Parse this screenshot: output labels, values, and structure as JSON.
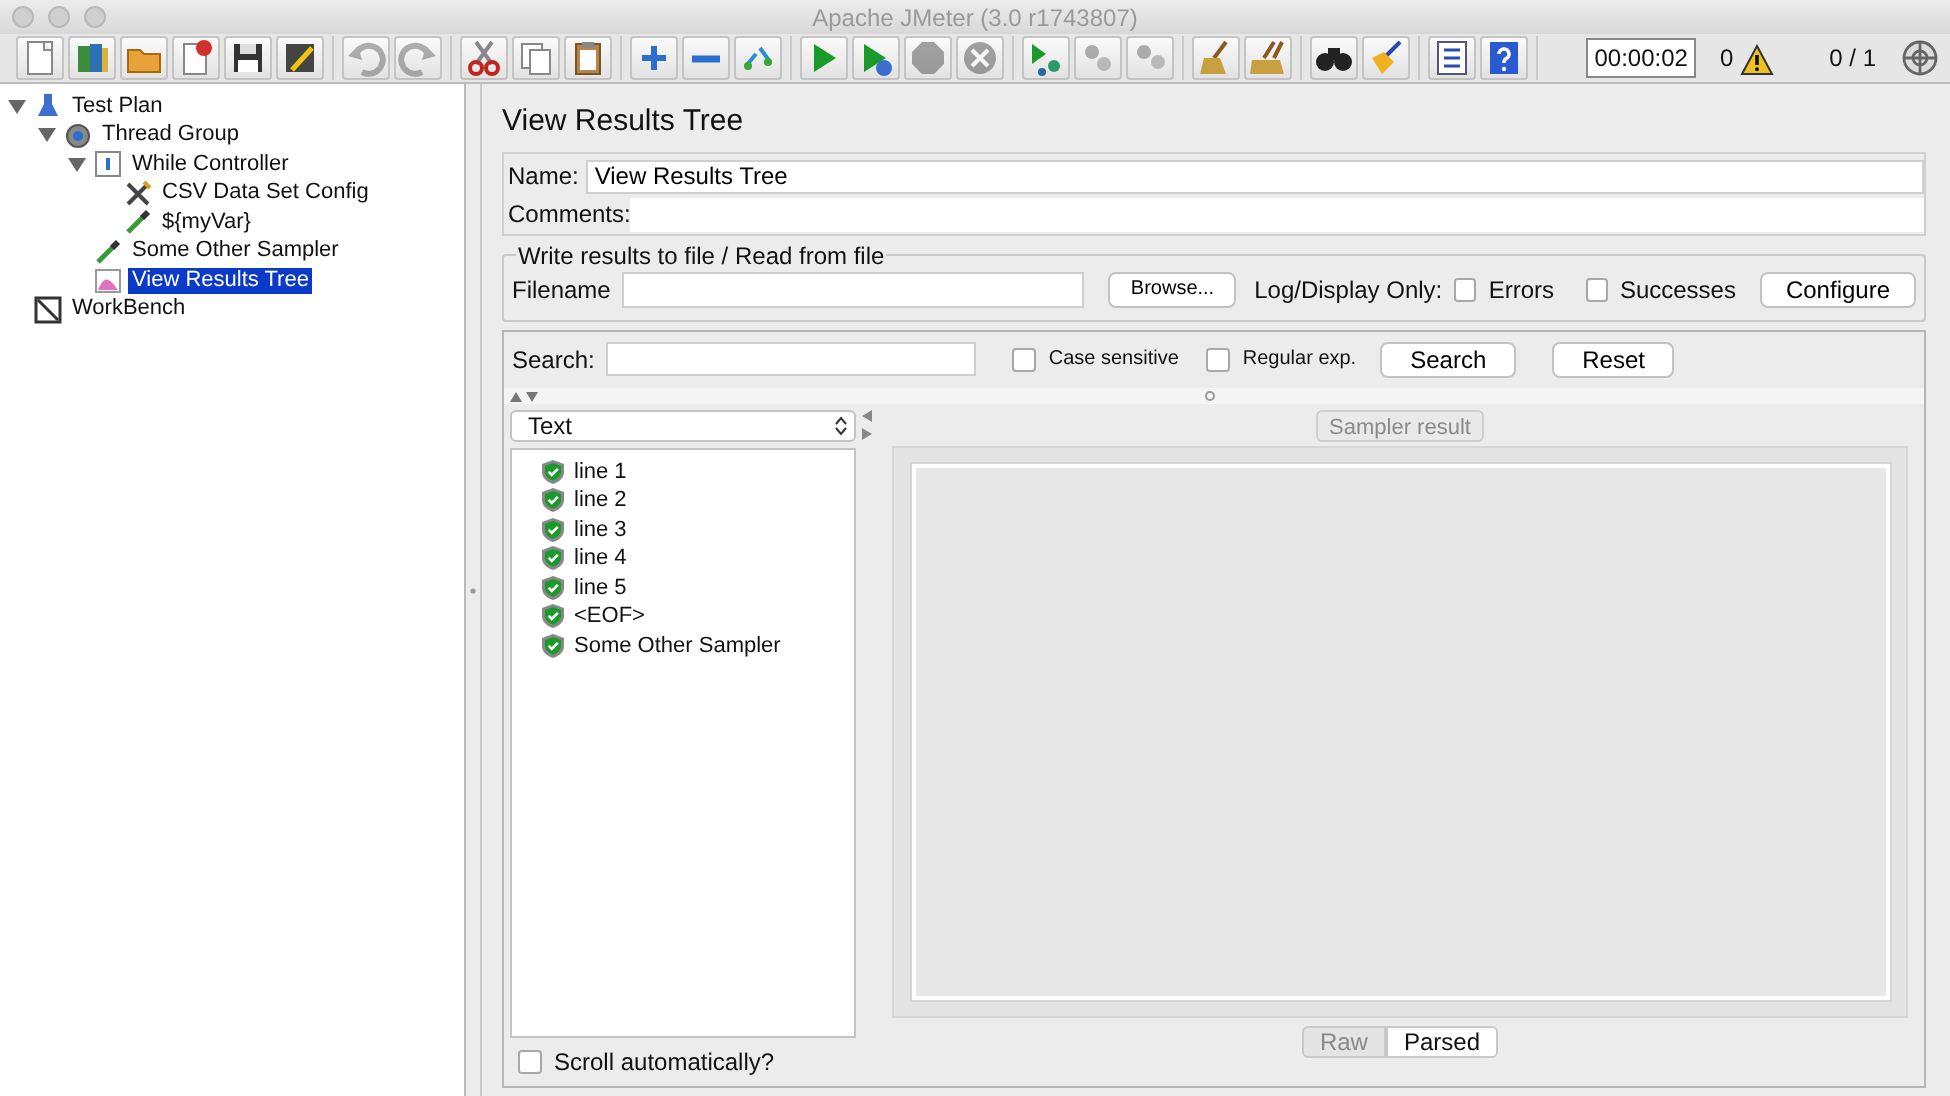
{
  "window": {
    "title": "Apache JMeter (3.0 r1743807)"
  },
  "toolbar": [
    [
      {
        "kind": "new",
        "disabled": false
      },
      {
        "kind": "templates",
        "disabled": false
      },
      {
        "kind": "open",
        "disabled": false
      },
      {
        "kind": "close",
        "disabled": false
      },
      {
        "kind": "save",
        "disabled": false
      },
      {
        "kind": "save-as",
        "disabled": false
      }
    ],
    [
      {
        "kind": "undo",
        "disabled": true
      },
      {
        "kind": "redo",
        "disabled": true
      }
    ],
    [
      {
        "kind": "cut",
        "disabled": false
      },
      {
        "kind": "copy",
        "disabled": false
      },
      {
        "kind": "paste",
        "disabled": false
      }
    ],
    [
      {
        "kind": "expand",
        "disabled": false
      },
      {
        "kind": "collapse",
        "disabled": false
      },
      {
        "kind": "toggle",
        "disabled": false
      }
    ],
    [
      {
        "kind": "start",
        "disabled": false
      },
      {
        "kind": "start-no-pause",
        "disabled": false
      },
      {
        "kind": "stop",
        "disabled": true
      },
      {
        "kind": "shutdown",
        "disabled": true
      }
    ],
    [
      {
        "kind": "remote-start",
        "disabled": false
      },
      {
        "kind": "remote-stop",
        "disabled": true
      },
      {
        "kind": "remote-exit",
        "disabled": true
      }
    ],
    [
      {
        "kind": "clear",
        "disabled": false
      },
      {
        "kind": "clear-all",
        "disabled": false
      }
    ],
    [
      {
        "kind": "search",
        "disabled": false
      },
      {
        "kind": "reset-search",
        "disabled": false
      }
    ],
    [
      {
        "kind": "function-helper",
        "disabled": false
      },
      {
        "kind": "help",
        "disabled": false
      }
    ]
  ],
  "status": {
    "timer": "00:00:02",
    "error_count": "0",
    "threads": "0 / 1"
  },
  "tree": [
    {
      "label": "Test Plan",
      "kind": "testplan",
      "expanded": true,
      "selected": false,
      "children": [
        {
          "label": "Thread Group",
          "kind": "threadgroup",
          "expanded": true,
          "selected": false,
          "children": [
            {
              "label": "While Controller",
              "kind": "controller",
              "expanded": true,
              "selected": false,
              "children": [
                {
                  "label": "CSV Data Set Config",
                  "kind": "config",
                  "selected": false
                },
                {
                  "label": "${myVar}",
                  "kind": "sampler",
                  "selected": false
                }
              ]
            },
            {
              "label": "Some Other Sampler",
              "kind": "sampler",
              "selected": false
            },
            {
              "label": "View Results Tree",
              "kind": "listener",
              "selected": true
            }
          ]
        }
      ]
    },
    {
      "label": "WorkBench",
      "kind": "workbench",
      "selected": false
    }
  ],
  "panel": {
    "title": "View Results Tree",
    "name_label": "Name:",
    "name_value": "View Results Tree",
    "comments_label": "Comments:",
    "file_group": {
      "legend": "Write results to file / Read from file",
      "filename_label": "Filename",
      "browse": "Browse...",
      "log_label": "Log/Display Only:",
      "errors": {
        "label": "Errors",
        "checked": false
      },
      "successes": {
        "label": "Successes",
        "checked": false
      },
      "configure": "Configure"
    },
    "search": {
      "label": "Search:",
      "case_sensitive": {
        "label": "Case sensitive",
        "checked": false
      },
      "regex": {
        "label": "Regular exp.",
        "checked": false
      },
      "search_button": "Search",
      "reset_button": "Reset"
    },
    "renderer": "Text",
    "results": [
      {
        "label": "line 1",
        "success": true
      },
      {
        "label": "line 2",
        "success": true
      },
      {
        "label": "line 3",
        "success": true
      },
      {
        "label": "line 4",
        "success": true
      },
      {
        "label": "line 5",
        "success": true
      },
      {
        "label": "<EOF>",
        "success": true
      },
      {
        "label": "Some Other Sampler",
        "success": true
      }
    ],
    "scroll_auto": {
      "label": "Scroll automatically?",
      "checked": false
    },
    "result_tab": {
      "label": "Sampler result",
      "disabled": true
    },
    "view_modes": [
      {
        "label": "Raw",
        "selected": false
      },
      {
        "label": "Parsed",
        "selected": true
      }
    ]
  }
}
